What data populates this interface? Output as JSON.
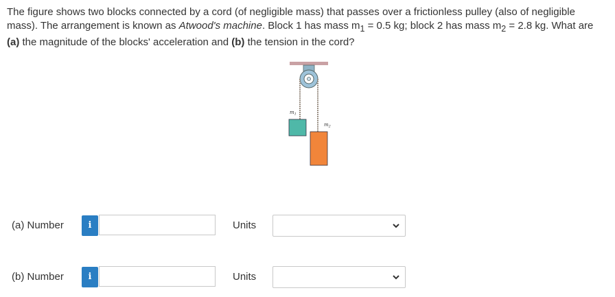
{
  "question": {
    "part1": "The figure shows two blocks connected by a cord (of negligible mass) that passes over a frictionless pulley (also of negligible mass). The arrangement is known as ",
    "italic": "Atwood's machine",
    "part2": ". Block 1 has mass m",
    "sub1": "1",
    "part3": " = 0.5 kg; block 2 has mass m",
    "sub2": "2",
    "part4": " = 2.8 kg. What are ",
    "bold_a": "(a)",
    "part5": " the magnitude of the blocks' acceleration and ",
    "bold_b": "(b)",
    "part6": " the tension in the cord?"
  },
  "figure": {
    "m1_label": "m",
    "m1_sub": "1",
    "m2_label": "m",
    "m2_sub": "2",
    "colors": {
      "ceiling": "#c9a1a4",
      "pulley": "#9ec3d9",
      "block1": "#4fb8a8",
      "block2": "#f1853a",
      "cord": "#9a8f84"
    }
  },
  "rows": [
    {
      "label": "(a) Number",
      "info_glyph": "i",
      "value": "",
      "units_label": "Units",
      "units_value": ""
    },
    {
      "label": "(b) Number",
      "info_glyph": "i",
      "value": "",
      "units_label": "Units",
      "units_value": ""
    }
  ]
}
